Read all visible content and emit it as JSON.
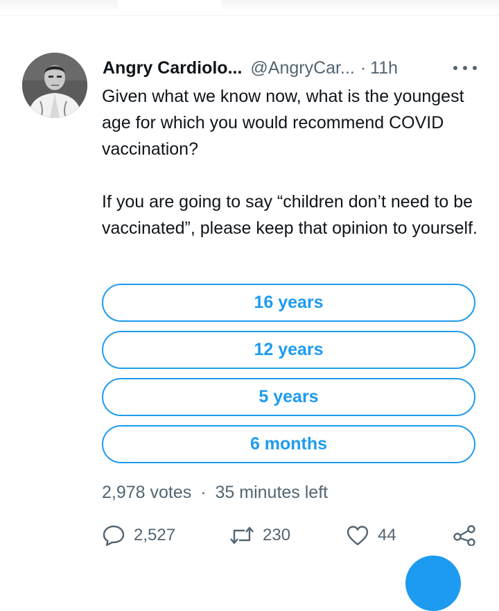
{
  "tweet": {
    "author_name": "Angry Cardiolo...",
    "author_handle": "@AngryCar...",
    "separator": "·",
    "time": "11h",
    "paragraphs": [
      "Given what we know now, what is the youngest age for which you would recommend COVID vaccination?",
      "If you are going to say “children don’t need to be vaccinated”, please keep that opinion to yourself."
    ]
  },
  "poll": {
    "options": [
      "16 years",
      "12 years",
      "5 years",
      "6 months"
    ],
    "votes": "2,978 votes",
    "separator": "·",
    "time_left": "35 minutes left"
  },
  "actions": {
    "replies": "2,527",
    "retweets": "230",
    "likes": "44"
  },
  "icons": {
    "more": "more-icon",
    "reply": "reply-icon",
    "retweet": "retweet-icon",
    "like": "like-icon",
    "share": "share-icon"
  },
  "colors": {
    "accent": "#1d9bf0",
    "text": "#0f1419",
    "secondary": "#536471"
  }
}
